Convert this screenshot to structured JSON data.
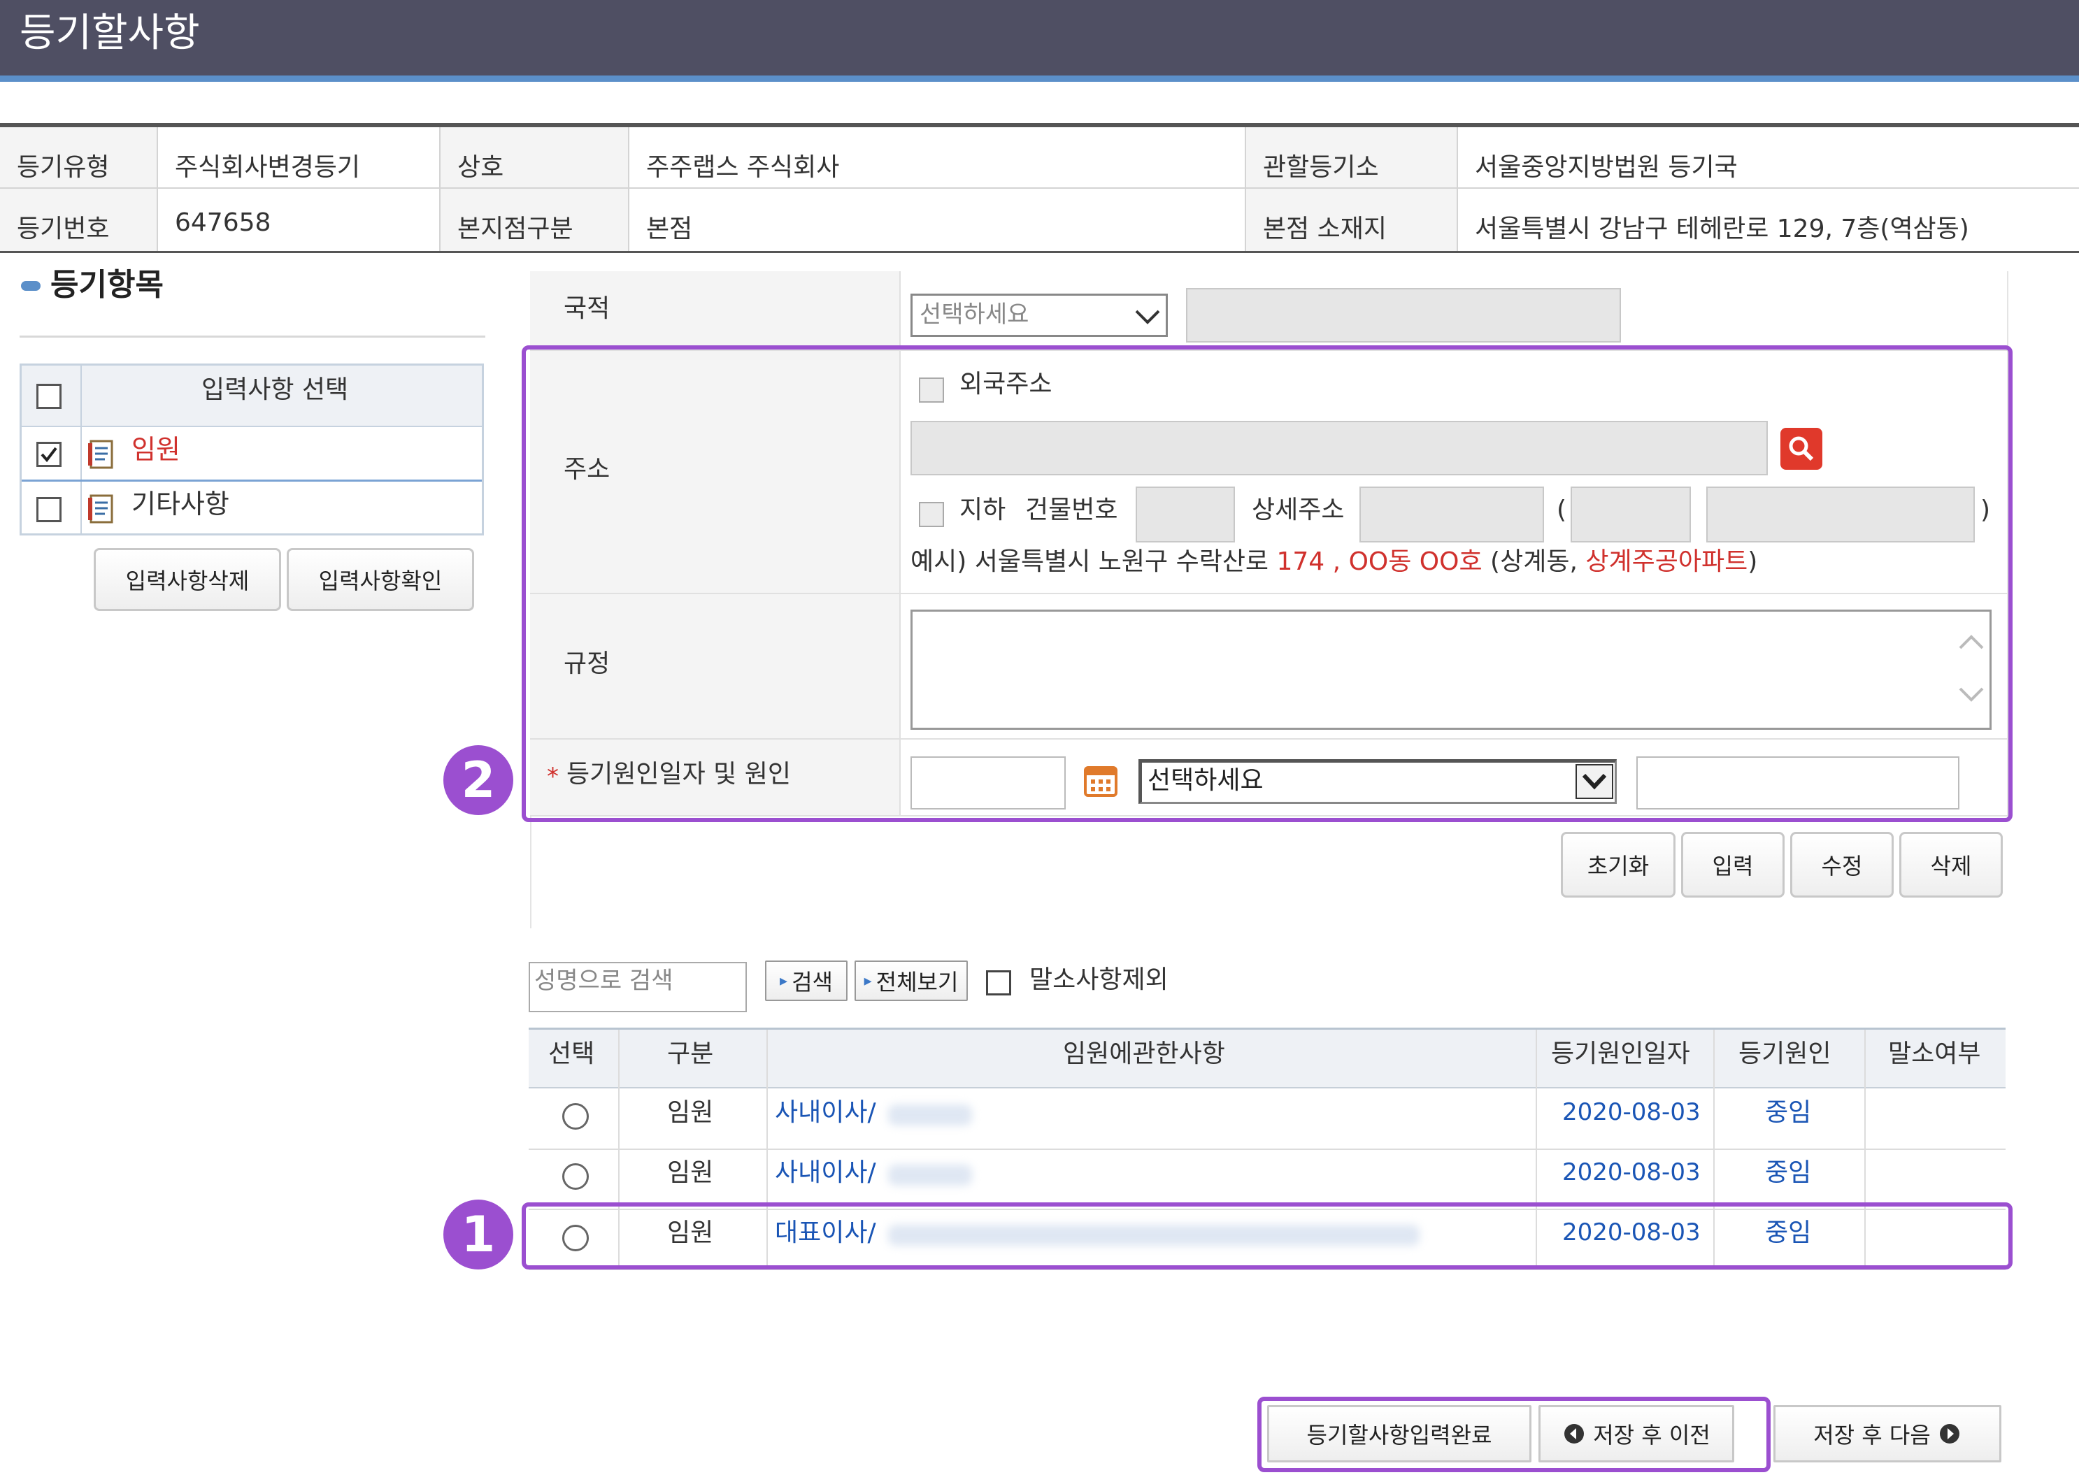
{
  "header": {
    "title": "등기할사항"
  },
  "info": {
    "type_label": "등기유형",
    "type_value": "주식회사변경등기",
    "name_label": "상호",
    "name_value": "주주랩스 주식회사",
    "office_label": "관할등기소",
    "office_value": "서울중앙지방법원 등기국",
    "number_label": "등기번호",
    "number_value": "647658",
    "branch_label": "본지점구분",
    "branch_value": "본점",
    "location_label": "본점 소재지",
    "location_value": "서울특별시 강남구 테헤란로 129, 7층(역삼동)"
  },
  "left": {
    "section_title": "등기항목",
    "list_header": "입력사항 선택",
    "items": [
      {
        "label": "임원",
        "checked": true
      },
      {
        "label": "기타사항",
        "checked": false
      }
    ],
    "delete_button": "입력사항삭제",
    "confirm_button": "입력사항확인"
  },
  "form": {
    "nationality_label": "국적",
    "nationality_select": "선택하세요",
    "address_label": "주소",
    "foreign_address_label": "외국주소",
    "basement_label": "지하",
    "building_no_label": "건물번호",
    "detail_address_label": "상세주소",
    "paren_open": "(",
    "paren_close": ")",
    "example_prefix": "예시) 서울특별시 노원구 수락산로 ",
    "example_num": "174",
    "example_comma": " , ",
    "example_unit": "OO동 OO호",
    "example_mid": " (상계동, ",
    "example_apt": "상계주공아파트",
    "example_end": ")",
    "rule_label": "규정",
    "cause_required": "*",
    "cause_label": "등기원인일자 및 원인",
    "cause_select": "선택하세요"
  },
  "actions": {
    "reset": "초기화",
    "input": "입력",
    "edit": "수정",
    "delete": "삭제"
  },
  "search": {
    "placeholder": "성명으로 검색",
    "search_button": "검색",
    "all_button": "전체보기",
    "exclude_label": "말소사항제외"
  },
  "table": {
    "headers": [
      "선택",
      "구분",
      "임원에관한사항",
      "등기원인일자",
      "등기원인",
      "말소여부"
    ],
    "rows": [
      {
        "type": "임원",
        "desc": "사내이사/",
        "date": "2020-08-03",
        "cause": "중임",
        "cancel": ""
      },
      {
        "type": "임원",
        "desc": "사내이사/",
        "date": "2020-08-03",
        "cause": "중임",
        "cancel": ""
      },
      {
        "type": "임원",
        "desc": "대표이사/",
        "date": "2020-08-03",
        "cause": "중임",
        "cancel": ""
      }
    ]
  },
  "badges": {
    "one": "1",
    "two": "2"
  },
  "footer": {
    "complete": "등기할사항입력완료",
    "save_prev": "저장 후 이전",
    "save_next": "저장 후 다음"
  },
  "colors": {
    "header_bg": "#4f4f63",
    "accent_blue": "#5b8fc9",
    "highlight": "#9b4fd0",
    "link": "#1a55b5",
    "red": "#d0312d"
  }
}
